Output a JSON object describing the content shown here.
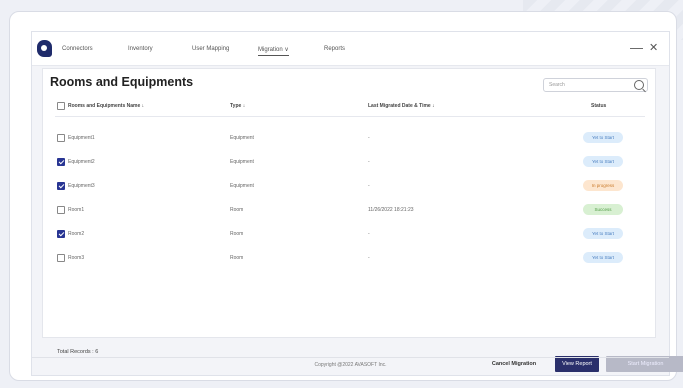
{
  "nav": {
    "items": [
      "Connectors",
      "Inventory",
      "User Mapping",
      "Migration",
      "Reports"
    ],
    "migration_caret": "∨",
    "minimize": "—",
    "close": "✕"
  },
  "page": {
    "title": "Rooms and Equipments",
    "search_placeholder": "Search"
  },
  "table": {
    "headers": {
      "name": "Rooms and Equipments Name ↓",
      "type": "Type ↓",
      "last_migrated": "Last Migrated Date & Time ↓",
      "status": "Status"
    },
    "rows": [
      {
        "name": "Equipment1",
        "type": "Equipment",
        "last": "-",
        "status": "Yet to Start",
        "checked": false
      },
      {
        "name": "Equipment2",
        "type": "Equipment",
        "last": "-",
        "status": "Yet to Start",
        "checked": true
      },
      {
        "name": "Equipment3",
        "type": "Equipment",
        "last": "-",
        "status": "In progress",
        "checked": true
      },
      {
        "name": "Room1",
        "type": "Room",
        "last": "11/26/2022 18:21:23",
        "status": "Success",
        "checked": false
      },
      {
        "name": "Room2",
        "type": "Room",
        "last": "-",
        "status": "Yet to Start",
        "checked": true
      },
      {
        "name": "Room3",
        "type": "Room",
        "last": "-",
        "status": "Yet to Start",
        "checked": false
      }
    ]
  },
  "status_colors": {
    "Yet to Start": {
      "bg": "#dcecfb",
      "fg": "#4a7fc0"
    },
    "In progress": {
      "bg": "#fde6cf",
      "fg": "#c97a2a"
    },
    "Success": {
      "bg": "#d8f0d2",
      "fg": "#4f9a43"
    }
  },
  "footer": {
    "total_records": "Total Records : 6",
    "cancel": "Cancel Migration",
    "view_report": "View Report",
    "start": "Start Migration"
  },
  "copyright": "Copyright @2022 AVASOFT Inc."
}
